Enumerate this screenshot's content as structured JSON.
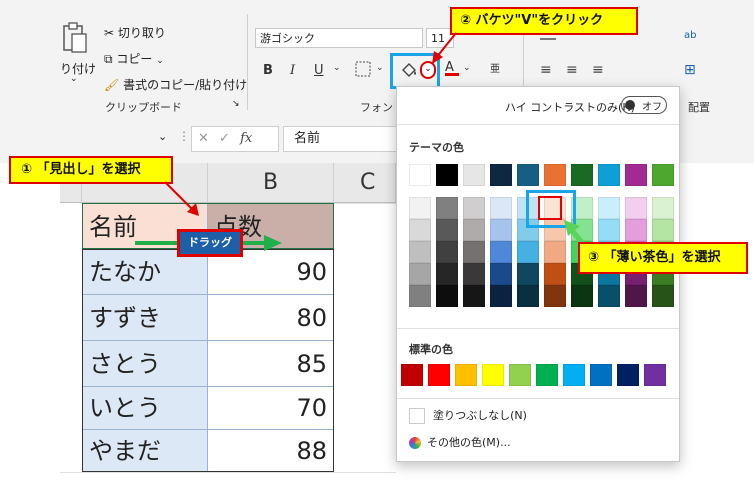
{
  "ribbon": {
    "paste_label": "り付け",
    "cut_label": "切り取り",
    "copy_label": "コピー",
    "format_painter_label": "書式のコピー/貼り付け",
    "clipboard_group": "クリップボード",
    "font_group": "フォント",
    "font_name": "游ゴシック",
    "font_size": "11",
    "bold": "B",
    "italic": "I",
    "underline": "U",
    "font_color_letter": "A",
    "align_group_partial": "配置",
    "right_partial": "ab"
  },
  "formula_bar": {
    "fx": "fx",
    "content": "名前"
  },
  "sheet": {
    "columns": [
      "B",
      "C"
    ],
    "rows": [
      {
        "name": "名前",
        "value": "点数"
      },
      {
        "name": "たなか",
        "value": "90"
      },
      {
        "name": "すずき",
        "value": "80"
      },
      {
        "name": "さとう",
        "value": "85"
      },
      {
        "name": "いとう",
        "value": "70"
      },
      {
        "name": "やまだ",
        "value": "88"
      }
    ],
    "drag_label": "ドラッグ"
  },
  "palette": {
    "high_contrast_label": "ハイ コントラストのみ(H)",
    "toggle_label": "オフ",
    "theme_title": "テーマの色",
    "standard_title": "標準の色",
    "no_fill": "塗りつぶしなし(N)",
    "more_colors": "その他の色(M)...",
    "theme_colors": [
      [
        "#ffffff",
        "#000000",
        "#e7e6e6",
        "#0e2841",
        "#156082",
        "#e97132",
        "#196b24",
        "#0f9ed5",
        "#a02b93",
        "#4ea72e"
      ],
      [
        "#f2f2f2",
        "#808080",
        "#d0cece",
        "#dbe7f7",
        "#c0e4f5",
        "#fbe3d6",
        "#c1f0c8",
        "#caeefb",
        "#f2cfee",
        "#daf2d0"
      ],
      [
        "#d9d9d9",
        "#595959",
        "#afabab",
        "#a6c3ec",
        "#83cbeb",
        "#f7c7ac",
        "#84e291",
        "#95ddf7",
        "#e59edd",
        "#b4e5a2"
      ],
      [
        "#bfbfbf",
        "#404040",
        "#767171",
        "#4e88d6",
        "#45b0e1",
        "#f1a983",
        "#47d45a",
        "#61cbf3",
        "#d86dcb",
        "#8ed973"
      ],
      [
        "#a6a6a6",
        "#262626",
        "#3a3838",
        "#1a4a8a",
        "#0f4761",
        "#c04f15",
        "#124f1a",
        "#0b76a0",
        "#782070",
        "#3b7d23"
      ],
      [
        "#808080",
        "#0d0d0d",
        "#171616",
        "#0b2240",
        "#0a2f40",
        "#80350e",
        "#0c3511",
        "#074f6a",
        "#501549",
        "#275317"
      ]
    ],
    "standard_colors": [
      "#c00000",
      "#ff0000",
      "#ffc000",
      "#ffff00",
      "#92d050",
      "#00b050",
      "#00b0f0",
      "#0070c0",
      "#002060",
      "#7030a0"
    ]
  },
  "callouts": {
    "step1": "① 「見出し」を選択",
    "step2": "② バケツ\"V\"をクリック",
    "step3": "③ 「薄い茶色」を選択"
  },
  "colors": {
    "header_fill": "#f9dfd4",
    "header_fill_selected": "#c9afa8",
    "data_fill": "#dce8f5",
    "callout_bg": "#ffff00",
    "callout_border": "#e00000",
    "highlight": "#1aa5e8",
    "drag_arrow": "#1fb04a"
  }
}
